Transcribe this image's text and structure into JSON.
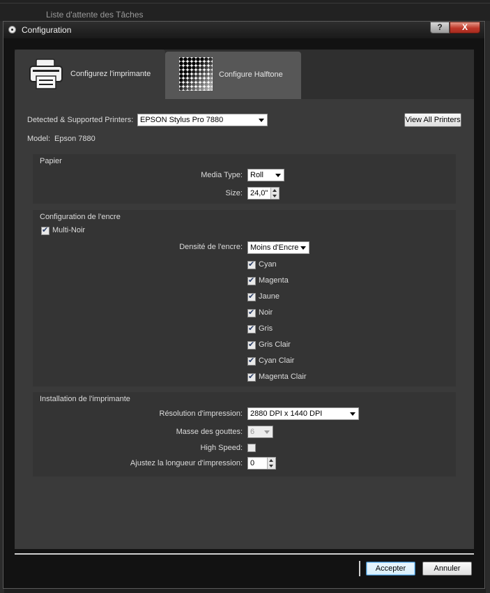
{
  "background_window": {
    "title": "Liste d'attente des Tâches"
  },
  "dialog": {
    "title": "Configuration",
    "help_label": "?",
    "close_label": "X",
    "app_icon": "app-icon"
  },
  "tabs": [
    {
      "label": "Configurez l'imprimante",
      "icon": "printer-icon"
    },
    {
      "label": "Configure Halftone",
      "icon": "halftone-icon"
    }
  ],
  "printer": {
    "detected_label": "Detected & Supported Printers:",
    "detected_value": "EPSON Stylus Pro 7880",
    "view_all_label": "View All Printers",
    "model_label": "Model:",
    "model_value": "Epson 7880"
  },
  "papier": {
    "title": "Papier",
    "media_type_label": "Media Type:",
    "media_type_value": "Roll",
    "size_label": "Size:",
    "size_value": "24,0\""
  },
  "encre": {
    "title": "Configuration de l'encre",
    "multi_noir_label": "Multi-Noir",
    "multi_noir_checked": true,
    "densite_label": "Densité de l'encre:",
    "densite_value": "Moins d'Encre",
    "inks": [
      {
        "label": "Cyan",
        "checked": true
      },
      {
        "label": "Magenta",
        "checked": true
      },
      {
        "label": "Jaune",
        "checked": true
      },
      {
        "label": "Noir",
        "checked": true
      },
      {
        "label": "Gris",
        "checked": true
      },
      {
        "label": "Gris Clair",
        "checked": true
      },
      {
        "label": "Cyan Clair",
        "checked": true
      },
      {
        "label": "Magenta Clair",
        "checked": true
      }
    ]
  },
  "installation": {
    "title": "Installation de l'imprimante",
    "resolution_label": "Résolution d'impression:",
    "resolution_value": "2880 DPI x 1440 DPI",
    "masse_label": "Masse des gouttes:",
    "masse_value": "6",
    "high_speed_label": "High Speed:",
    "high_speed_checked": false,
    "longueur_label": "Ajustez la longueur d'impression:",
    "longueur_value": "0"
  },
  "footer": {
    "accept_label": "Accepter",
    "cancel_label": "Annuler"
  },
  "colors": {
    "panel": "#3a3a3a",
    "section": "#343434",
    "close_red": "#c0392b",
    "accept_border": "#3c7fb1"
  }
}
